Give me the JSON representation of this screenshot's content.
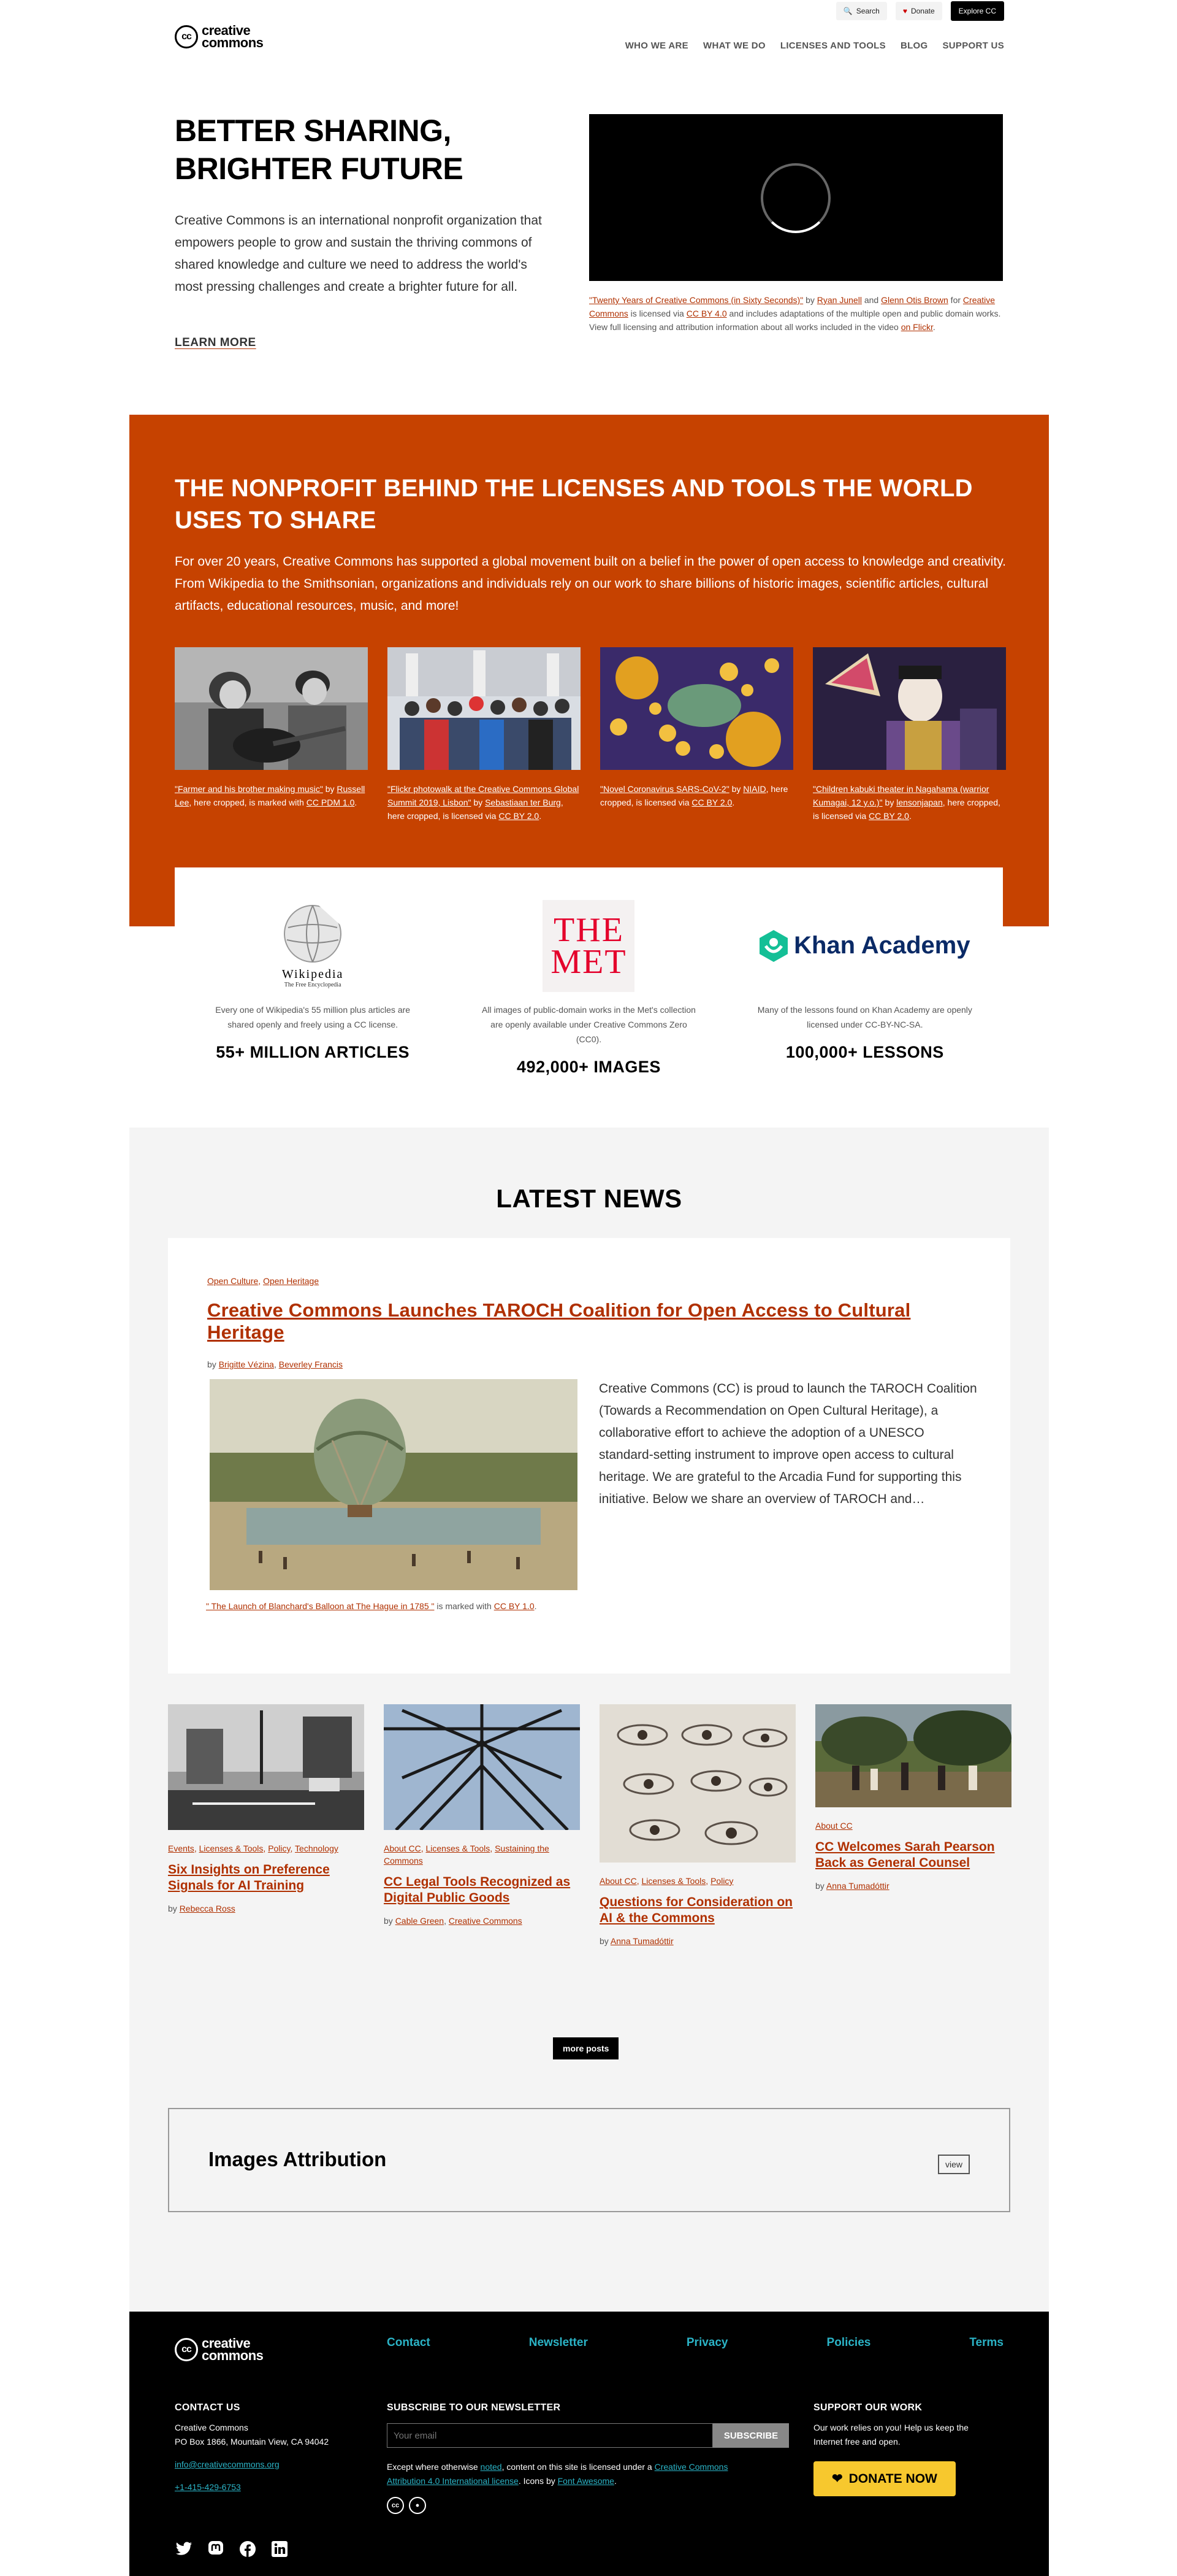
{
  "topbar": {
    "search": "Search",
    "donate": "Donate",
    "explore": "Explore CC"
  },
  "logo": {
    "mark": "cc",
    "line1": "creative",
    "line2": "commons"
  },
  "nav": [
    "WHO WE ARE",
    "WHAT WE DO",
    "LICENSES AND TOOLS",
    "BLOG",
    "SUPPORT US"
  ],
  "hero": {
    "title": "BETTER SHARING, BRIGHTER FUTURE",
    "text": "Creative Commons is an international nonprofit organization that empowers people to grow and sustain the thriving commons of shared knowledge and culture we need to address the world's most pressing challenges and create a brighter future for all.",
    "link": "LEARN MORE",
    "caption": {
      "t1": "\"Twenty Years of Creative Commons (in Sixty Seconds)\"",
      "t2": " by ",
      "a1": "Ryan Junell",
      "t3": " and ",
      "a2": "Glenn Otis Brown",
      "t4": " for ",
      "a3": "Creative Commons",
      "t5": " is licensed via ",
      "a4": "CC BY 4.0",
      "t6": " and includes adaptations of the multiple open and public domain works. View full licensing and attribution information about all works included in the video ",
      "a5": "on Flickr",
      "t7": "."
    }
  },
  "nonprofit": {
    "title": "THE NONPROFIT BEHIND THE LICENSES AND TOOLS THE WORLD USES TO SHARE",
    "text": "For over 20 years, Creative Commons has supported a global movement built on a belief in the power of open access to knowledge and creativity. From Wikipedia to the Smithsonian, organizations and individuals rely on our work to share billions of historic images, scientific articles, cultural artifacts, educational resources, music, and more!",
    "images": [
      {
        "link": "\"Farmer and his brother making music\"",
        "mid": " by ",
        "author": "Russell Lee",
        "rest": ", here cropped, is marked with ",
        "lic": "CC PDM 1.0",
        "end": "."
      },
      {
        "link": "\"Flickr photowalk at the Creative Commons Global Summit 2019, Lisbon\"",
        "mid": " by ",
        "author": "Sebastiaan ter Burg",
        "rest": ", here cropped, is licensed via ",
        "lic": "CC BY 2.0",
        "end": "."
      },
      {
        "link": "\"Novel Coronavirus SARS-CoV-2\"",
        "mid": " by ",
        "author": "NIAID",
        "rest": ", here cropped, is licensed via ",
        "lic": "CC BY 2.0",
        "end": "."
      },
      {
        "link": "\"Children kabuki theater in Nagahama (warrior Kumagai, 12 y.o.)\"",
        "mid": " by ",
        "author": "lensonjapan",
        "rest": ", here cropped, is licensed via ",
        "lic": "CC BY 2.0",
        "end": "."
      }
    ]
  },
  "stats": [
    {
      "logo": "Wikipedia",
      "logo_sub": "The Free Encyclopedia",
      "text": "Every one of Wikipedia's 55 million plus articles are shared openly and freely using a CC license.",
      "num": "55+ MILLION ARTICLES"
    },
    {
      "logo": "THE MET",
      "logo_a": "THE",
      "logo_b": "MET",
      "text": "All images of public-domain works in the Met's collection are openly available under Creative Commons Zero (CC0).",
      "num": "492,000+ IMAGES"
    },
    {
      "logo": "Khan Academy",
      "text": "Many of the lessons found on Khan Academy are openly licensed under CC-BY-NC-SA.",
      "num": "100,000+ LESSONS"
    }
  ],
  "news": {
    "title": "LATEST NEWS",
    "featured": {
      "tags": [
        "Open Culture",
        "Open Heritage"
      ],
      "title": "Creative Commons Launches TAROCH Coalition for Open Access to Cultural Heritage",
      "by": "by",
      "authors": [
        "Brigitte Vézina",
        "Beverley Francis"
      ],
      "text": "Creative Commons (CC) is proud to launch the TAROCH Coalition (Towards a Recommendation on Open Cultural Heritage), a collaborative effort to achieve the adoption of a UNESCO standard-setting instrument to improve open access to cultural heritage. We are grateful to the Arcadia Fund for supporting this initiative. Below we share an overview of TAROCH and…",
      "caption_link": "\" The Launch of Blanchard's Balloon at The Hague in 1785 \"",
      "caption_mid": " is marked with ",
      "caption_lic": "CC BY 1.0",
      "caption_end": "."
    },
    "cards": [
      {
        "tags": [
          "Events",
          "Licenses & Tools",
          "Policy",
          "Technology"
        ],
        "title": "Six Insights on Preference Signals for AI Training",
        "author": "Rebecca Ross"
      },
      {
        "tags": [
          "About CC",
          "Licenses & Tools",
          "Sustaining the Commons"
        ],
        "title": "CC Legal Tools Recognized as Digital Public Goods",
        "author": "Cable Green",
        "author2": "Creative Commons"
      },
      {
        "tags": [
          "About CC",
          "Licenses & Tools",
          "Policy"
        ],
        "title": "Questions for Consideration on AI & the Commons",
        "author": "Anna Tumadóttir"
      },
      {
        "tags": [
          "About CC"
        ],
        "title": "CC Welcomes Sarah Pearson Back as General Counsel",
        "author": "Anna Tumadóttir"
      }
    ],
    "more": "more posts",
    "attribution": "Images Attribution",
    "view": "view"
  },
  "footer": {
    "links": [
      "Contact",
      "Newsletter",
      "Privacy",
      "Policies",
      "Terms"
    ],
    "contact_h": "CONTACT US",
    "contact_name": "Creative Commons",
    "contact_addr": "PO Box 1866, Mountain View, CA 94042",
    "contact_email": "info@creativecommons.org",
    "contact_phone": "+1-415-429-6753",
    "news_h": "SUBSCRIBE TO OUR NEWSLETTER",
    "news_placeholder": "Your email",
    "news_btn": "SUBSCRIBE",
    "legal_1": "Except where otherwise ",
    "legal_noted": "noted",
    "legal_2": ", content on this site is licensed under a ",
    "legal_lic": "Creative Commons Attribution 4.0 International license",
    "legal_3": ". Icons by ",
    "legal_fa": "Font Awesome",
    "legal_4": ".",
    "support_h": "SUPPORT OUR WORK",
    "support_text": "Our work relies on you! Help us keep the Internet free and open.",
    "donate": "DONATE NOW"
  },
  "colors": {
    "accent": "#c64200",
    "link": "#b03000",
    "footer_link": "#2bb3c6",
    "donate": "#f7c82e"
  }
}
